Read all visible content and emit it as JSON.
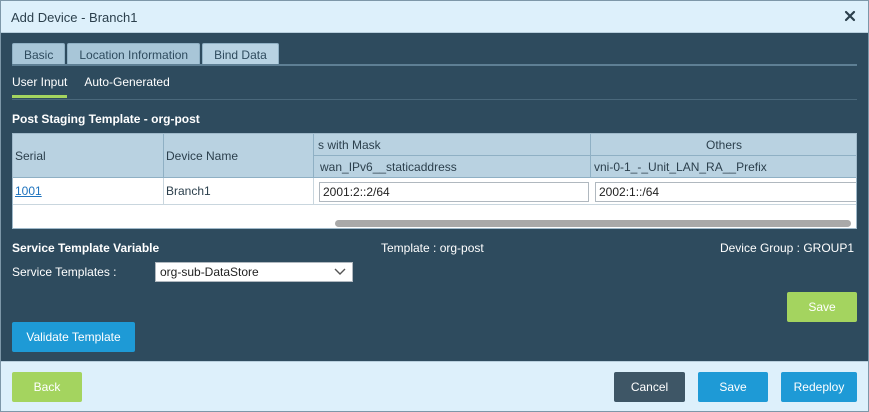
{
  "dialog": {
    "title": "Add Device - Branch1"
  },
  "tabs": [
    {
      "label": "Basic"
    },
    {
      "label": "Location Information"
    },
    {
      "label": "Bind Data",
      "active": true
    }
  ],
  "subtabs": [
    {
      "label": "User Input",
      "active": true
    },
    {
      "label": "Auto-Generated"
    }
  ],
  "post_staging": {
    "title": "Post Staging Template - org-post",
    "group_headers": [
      "s with Mask",
      "Others"
    ],
    "columns": [
      "Serial",
      "Device Name",
      "wan_IPv6__staticaddress",
      "vni-0-1_-_Unit_LAN_RA__Prefix"
    ],
    "rows": [
      {
        "serial": "1001",
        "device_name": "Branch1",
        "wan_ipv6": "2001:2::2/64",
        "lan_prefix": "2002:1::/64"
      }
    ]
  },
  "service": {
    "title": "Service Template Variable",
    "template_label": "Template : org-post",
    "device_group_label": "Device Group : GROUP1",
    "templates_label": "Service Templates :",
    "selected_template": "org-sub-DataStore",
    "save_label": "Save"
  },
  "validate_label": "Validate Template",
  "footer": {
    "back_label": "Back",
    "cancel_label": "Cancel",
    "save_label": "Save",
    "redeploy_label": "Redeploy"
  },
  "colors": {
    "body_bg": "#2e4b5e",
    "header_bg": "#ddf0fb",
    "accent_green": "#a4d45f",
    "accent_blue": "#1e9ad6",
    "cancel_bg": "#3e5666"
  },
  "icons": {
    "close": "close-icon",
    "select_arrow": "chevron-down-icon"
  }
}
